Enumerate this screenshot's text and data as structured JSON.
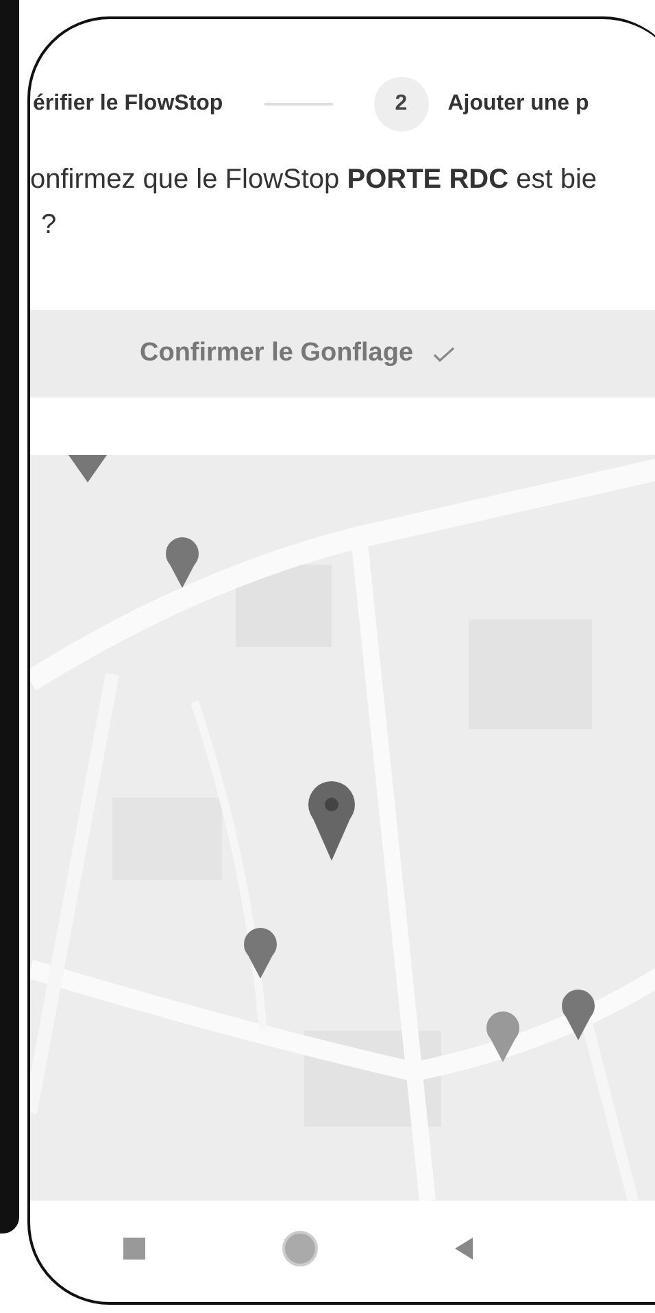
{
  "stepper": {
    "steps": [
      {
        "label": "érifier le FlowStop"
      },
      {
        "label": "Ajouter une p",
        "number": "2"
      }
    ]
  },
  "question": {
    "text": "onfirmez que le FlowStop **PORTE RDC** est bie",
    "continuation": "?"
  },
  "confirm_button": {
    "label": "Confirmer le Gonflage"
  }
}
